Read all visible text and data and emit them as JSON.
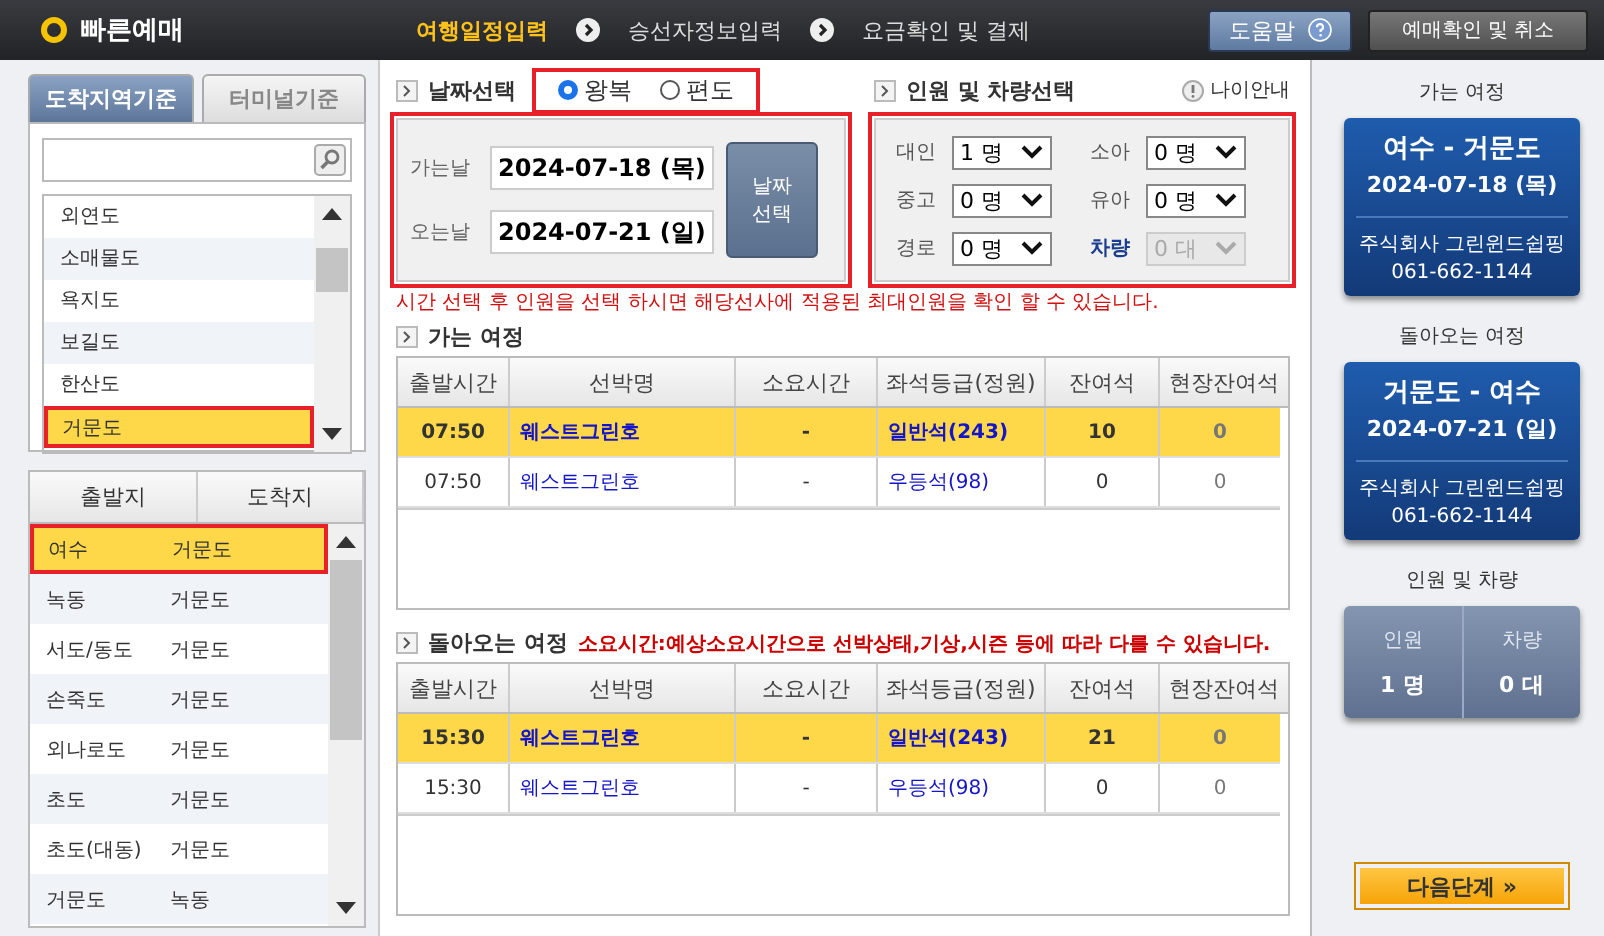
{
  "header": {
    "logo": "빠른예매",
    "steps": [
      {
        "label": "여행일정입력",
        "selected": true
      },
      {
        "label": "승선자정보입력",
        "selected": false
      },
      {
        "label": "요금확인 및 결제",
        "selected": false
      }
    ],
    "help_button": "도움말",
    "check_button": "예매확인 및 취소"
  },
  "left": {
    "tabs": [
      {
        "label": "도착지역기준",
        "selected": true
      },
      {
        "label": "터미널기준",
        "selected": false
      }
    ],
    "regions": [
      {
        "name": "외연도",
        "selected": false
      },
      {
        "name": "소매물도",
        "selected": false
      },
      {
        "name": "욕지도",
        "selected": false
      },
      {
        "name": "보길도",
        "selected": false
      },
      {
        "name": "한산도",
        "selected": false
      },
      {
        "name": "거문도",
        "selected": true,
        "highlighted": true
      }
    ],
    "route_columns": [
      "출발지",
      "도착지"
    ],
    "routes": [
      {
        "from": "여수",
        "to": "거문도",
        "selected": true,
        "highlighted": true
      },
      {
        "from": "녹동",
        "to": "거문도",
        "selected": false
      },
      {
        "from": "서도/동도",
        "to": "거문도",
        "selected": false
      },
      {
        "from": "손죽도",
        "to": "거문도",
        "selected": false
      },
      {
        "from": "외나로도",
        "to": "거문도",
        "selected": false
      },
      {
        "from": "초도",
        "to": "거문도",
        "selected": false
      },
      {
        "from": "초도(대동)",
        "to": "거문도",
        "selected": false
      },
      {
        "from": "거문도",
        "to": "녹동",
        "selected": false
      }
    ]
  },
  "date": {
    "title": "날짜선택",
    "highlighted": true,
    "trip_types": [
      {
        "label": "왕복",
        "selected": true
      },
      {
        "label": "편도",
        "selected": false
      }
    ],
    "fields": [
      {
        "label": "가는날",
        "value": "2024-07-18 (목)"
      },
      {
        "label": "오는날",
        "value": "2024-07-21 (일)"
      }
    ],
    "button": "날짜\n선택"
  },
  "people": {
    "title": "인원 및 차량선택",
    "age_info": "나이안내",
    "highlighted": true,
    "selects": [
      {
        "label": "대인",
        "value": "1 명",
        "disabled": false
      },
      {
        "label": "소아",
        "value": "0 명",
        "disabled": false
      },
      {
        "label": "중고",
        "value": "0 명",
        "disabled": false
      },
      {
        "label": "유아",
        "value": "0 명",
        "disabled": false
      },
      {
        "label": "경로",
        "value": "0 명",
        "disabled": false
      },
      {
        "label": "차량",
        "value": "0 대",
        "disabled": true
      }
    ]
  },
  "notice": "시간 선택 후 인원을 선택 하시면 해당선사에 적용된 최대인원을 확인 할 수 있습니다.",
  "trips": [
    {
      "title": "가는 여정",
      "columns": [
        "출발시간",
        "선박명",
        "소요시간",
        "좌석등급(정원)",
        "잔여석",
        "현장잔여석"
      ],
      "rows": [
        {
          "cells": [
            "07:50",
            "웨스트그린호",
            "-",
            "일반석(243)",
            "10",
            "0"
          ],
          "selected": true
        },
        {
          "cells": [
            "07:50",
            "웨스트그린호",
            "-",
            "우등석(98)",
            "0",
            "0"
          ],
          "selected": false
        }
      ]
    },
    {
      "title": "돌아오는 여정",
      "note": "소요시간:예상소요시간으로 선박상태,기상,시즌 등에 따라 다를 수 있습니다.",
      "columns": [
        "출발시간",
        "선박명",
        "소요시간",
        "좌석등급(정원)",
        "잔여석",
        "현장잔여석"
      ],
      "rows": [
        {
          "cells": [
            "15:30",
            "웨스트그린호",
            "-",
            "일반석(243)",
            "21",
            "0"
          ],
          "selected": true
        },
        {
          "cells": [
            "15:30",
            "웨스트그린호",
            "-",
            "우등석(98)",
            "0",
            "0"
          ],
          "selected": false
        }
      ]
    }
  ],
  "summary": {
    "trips": [
      {
        "label": "가는 여정",
        "route": "여수 - 거문도",
        "date": "2024-07-18 (목)",
        "company": "주식회사 그린윈드쉽핑",
        "phone": "061-662-1144"
      },
      {
        "label": "돌아오는 여정",
        "route": "거문도 - 여수",
        "date": "2024-07-21 (일)",
        "company": "주식회사 그린윈드쉽핑",
        "phone": "061-662-1144"
      }
    ],
    "counts_label": "인원 및 차량",
    "counts": [
      {
        "label": "인원",
        "value": "1 명"
      },
      {
        "label": "차량",
        "value": "0 대"
      }
    ],
    "next_button": "다음단계 »",
    "next_highlighted": true
  }
}
